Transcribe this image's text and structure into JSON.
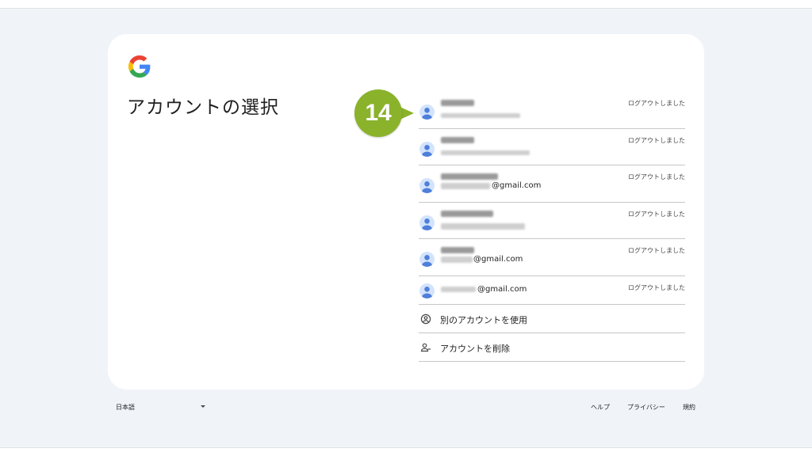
{
  "page": {
    "heading": "アカウントの選択"
  },
  "accounts": [
    {
      "email_visible": "",
      "status": "ログアウトしました"
    },
    {
      "email_visible": "",
      "status": "ログアウトしました"
    },
    {
      "email_visible": "@gmail.com",
      "status": "ログアウトしました"
    },
    {
      "email_visible": "",
      "status": "ログアウトしました"
    },
    {
      "email_visible": "@gmail.com",
      "status": "ログアウトしました"
    },
    {
      "email_visible": "@gmail.com",
      "status": "ログアウトしました"
    }
  ],
  "actions": {
    "use_another": "別のアカウントを使用",
    "remove": "アカウントを削除"
  },
  "annotation": {
    "step_number": "14",
    "color": "#8ab22b"
  },
  "footer": {
    "language": "日本語",
    "help": "ヘルプ",
    "privacy": "プライバシー",
    "terms": "規約"
  },
  "colors": {
    "background": "#f0f4f9",
    "card": "#ffffff",
    "avatar": "#d3e3fd",
    "avatar_person": "#4f7fd9"
  }
}
